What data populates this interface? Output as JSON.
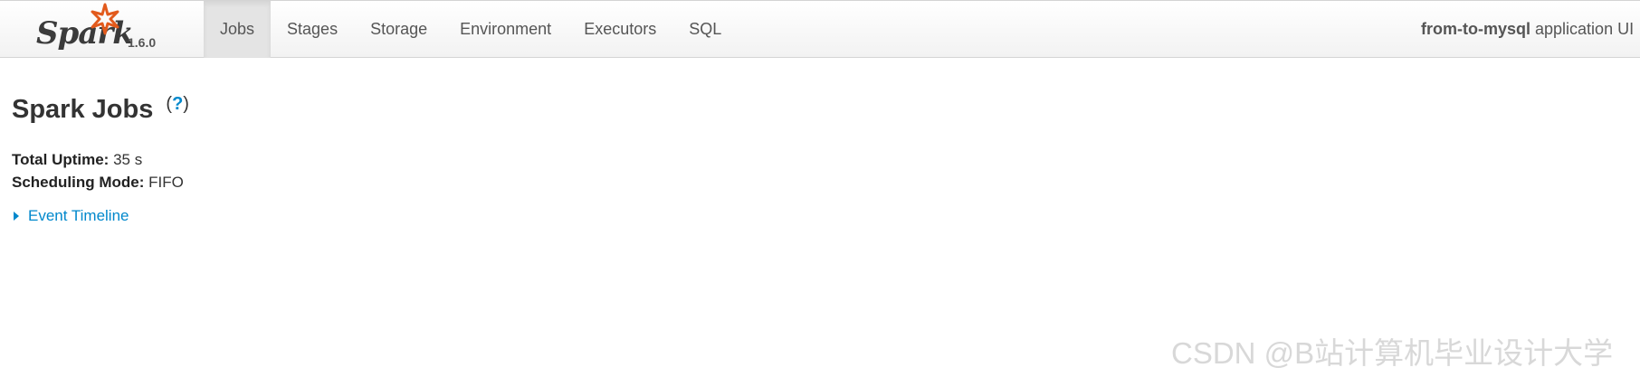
{
  "brand": {
    "name": "Spark",
    "version": "1.6.0",
    "logo_icon": "spark-star-icon",
    "accent": "#e25a1c"
  },
  "nav": {
    "tabs": [
      {
        "label": "Jobs",
        "active": true
      },
      {
        "label": "Stages",
        "active": false
      },
      {
        "label": "Storage",
        "active": false
      },
      {
        "label": "Environment",
        "active": false
      },
      {
        "label": "Executors",
        "active": false
      },
      {
        "label": "SQL",
        "active": false
      }
    ],
    "app_name": "from-to-mysql",
    "app_suffix": "application UI"
  },
  "page": {
    "title": "Spark Jobs",
    "help_open": "(",
    "help_label": "?",
    "help_close": ")",
    "uptime_label": "Total Uptime:",
    "uptime_value": "35 s",
    "scheduling_label": "Scheduling Mode:",
    "scheduling_value": "FIFO",
    "timeline_label": "Event Timeline",
    "link_color": "#0088cc"
  },
  "watermark": "CSDN @B站计算机毕业设计大学"
}
